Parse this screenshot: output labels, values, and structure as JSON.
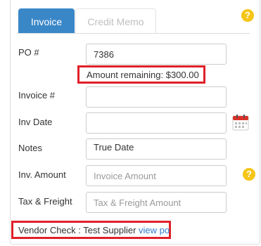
{
  "tabs": [
    {
      "label": "Invoice",
      "active": true
    },
    {
      "label": "Credit Memo",
      "active": false
    }
  ],
  "help_glyph": "?",
  "form": {
    "po": {
      "label": "PO #",
      "value": "7386"
    },
    "amount_remaining": "Amount remaining: $300.00",
    "invoice_no": {
      "label": "Invoice #",
      "value": ""
    },
    "inv_date": {
      "label": "Inv Date",
      "value": ""
    },
    "notes": {
      "label": "Notes",
      "value": "True Date"
    },
    "inv_amount": {
      "label": "Inv. Amount",
      "placeholder": "Invoice Amount"
    },
    "tax_freight": {
      "label": "Tax & Freight",
      "placeholder": "Tax & Freight Amount"
    }
  },
  "vendor_check": {
    "label": "Vendor Check : Test Supplier",
    "link": "view po"
  },
  "colors": {
    "accent": "#3a87c8",
    "highlight": "#e0202a",
    "help": "#f5c518",
    "link": "#2f7ccf"
  },
  "icons": {
    "help": "help-icon",
    "calendar": "calendar-icon"
  }
}
